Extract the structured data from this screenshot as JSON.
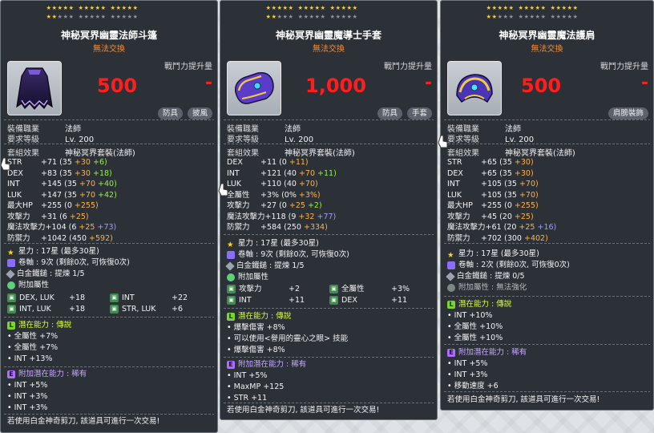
{
  "tooltips": [
    {
      "stars_row1": "★★★★★ ★★★★★ ★★★★★",
      "stars_row2": "★★★★★ ★★★★★ ★★★★★",
      "stars_filled": 17,
      "title": "神秘冥界幽靈法師斗篷",
      "untradable": "無法交換",
      "power_label": "戰鬥力提升量",
      "power_value": "500",
      "power_dash": "-",
      "icon": "cape-icon",
      "tags": [
        "防具",
        "披風"
      ],
      "job_label": "裝備職業",
      "job_value": "法師",
      "level_label": "要求等級",
      "level_value": "Lv. 200",
      "set_label": "套組效果",
      "set_value": "神秘冥界套裝(法師)",
      "stats": [
        [
          "STR",
          "+71",
          "(35",
          "+30",
          "+6)"
        ],
        [
          "DEX",
          "+83",
          "(35",
          "+30",
          "+18)"
        ],
        [
          "INT",
          "+145",
          "(35",
          "+70",
          "+40)"
        ],
        [
          "LUK",
          "+147",
          "(35",
          "+70",
          "+42)"
        ],
        [
          "最大HP",
          "+255",
          "(0",
          "+255)",
          ""
        ],
        [
          "攻擊力",
          "+31",
          "(6",
          "+25)",
          ""
        ],
        [
          "魔法攻擊力",
          "+104",
          "(6",
          "+25",
          "+73)"
        ],
        [
          "防禦力",
          "+1042",
          "(450",
          "+592)",
          ""
        ]
      ],
      "star_force": "星力 : 17星 (最多30星)",
      "scroll": "卷軸 : 9次 (剩餘0次, 可恢復0次)",
      "hammer": "白金鐵鎚 : 提煉 1/5",
      "additional_title": "附加屬性",
      "additional": [
        [
          "DEX, LUK",
          "+18",
          "INT",
          "+22"
        ],
        [
          "INT, LUK",
          "+18",
          "STR, LUK",
          "+6"
        ]
      ],
      "potential_title": "潛在能力 : 傳說",
      "potential": [
        "全屬性 +7%",
        "全屬性 +7%",
        "INT +13%"
      ],
      "bonus_title": "附加潛在能力 : 稀有",
      "bonus": [
        "INT +5%",
        "INT +3%",
        "INT +3%"
      ],
      "footer": "若使用白金神奇剪刀, 該道具可進行一次交易!"
    },
    {
      "stars_row1": "★★★★★ ★★★★★ ★★★★★",
      "stars_row2": "★★★★★ ★★★★★ ★★★★★",
      "stars_filled": 17,
      "title": "神秘冥界幽靈魔導士手套",
      "untradable": "無法交換",
      "power_label": "戰鬥力提升量",
      "power_value": "1,000",
      "power_dash": "-",
      "icon": "glove-icon",
      "tags": [
        "防具",
        "手套"
      ],
      "job_label": "裝備職業",
      "job_value": "法師",
      "level_label": "要求等級",
      "level_value": "Lv. 200",
      "set_label": "套組效果",
      "set_value": "神秘冥界套裝(法師)",
      "stats": [
        [
          "DEX",
          "+11",
          "(0",
          "+11)",
          ""
        ],
        [
          "INT",
          "+121",
          "(40",
          "+70",
          "+11)"
        ],
        [
          "LUK",
          "+110",
          "(40",
          "+70)",
          ""
        ],
        [
          "全屬性",
          "+3%",
          "(0%",
          "+3%)",
          ""
        ],
        [
          "攻擊力",
          "+27",
          "(0",
          "+25",
          "+2)"
        ],
        [
          "魔法攻擊力",
          "+118",
          "(9",
          "+32",
          "+77)"
        ],
        [
          "防禦力",
          "+584",
          "(250",
          "+334)",
          ""
        ]
      ],
      "star_force": "星力 : 17星 (最多30星)",
      "scroll": "卷軸 : 9次 (剩餘0次, 可恢復0次)",
      "hammer": "白金鐵鎚 : 提煉 1/5",
      "additional_title": "附加屬性",
      "additional": [
        [
          "攻擊力",
          "+2",
          "全屬性",
          "+3%"
        ],
        [
          "INT",
          "+11",
          "DEX",
          "+11"
        ]
      ],
      "potential_title": "潛在能力 : 傳說",
      "potential": [
        "爆擊傷害 +8%",
        "可以使用<譽用的靈心之眼> 技能",
        "爆擊傷害 +8%"
      ],
      "bonus_title": "附加潛在能力 : 稀有",
      "bonus": [
        "INT +5%",
        "MaxMP +125",
        "STR +11"
      ],
      "footer": "若使用白金神奇剪刀, 該道具可進行一次交易!"
    },
    {
      "stars_row1": "★★★★★ ★★★★★ ★★★★★",
      "stars_row2": "★★★★★ ★★★★★ ★★★★★",
      "stars_filled": 17,
      "title": "神秘冥界幽靈魔法護肩",
      "untradable": "無法交換",
      "power_label": "戰鬥力提升量",
      "power_value": "500",
      "power_dash": "-",
      "icon": "shoulder-icon",
      "tags": [
        "肩膀裝飾"
      ],
      "job_label": "裝備職業",
      "job_value": "法師",
      "level_label": "要求等級",
      "level_value": "Lv. 200",
      "set_label": "套組效果",
      "set_value": "神秘冥界套裝(法師)",
      "stats": [
        [
          "STR",
          "+65",
          "(35",
          "+30)",
          ""
        ],
        [
          "DEX",
          "+65",
          "(35",
          "+30)",
          ""
        ],
        [
          "INT",
          "+105",
          "(35",
          "+70)",
          ""
        ],
        [
          "LUK",
          "+105",
          "(35",
          "+70)",
          ""
        ],
        [
          "最大HP",
          "+255",
          "(0",
          "+255)",
          ""
        ],
        [
          "攻擊力",
          "+45",
          "(20",
          "+25)",
          ""
        ],
        [
          "魔法攻擊力",
          "+61",
          "(20",
          "+25",
          "+16)"
        ],
        [
          "防禦力",
          "+702",
          "(300",
          "+402)",
          ""
        ]
      ],
      "star_force": "星力 : 17星 (最多30星)",
      "scroll": "卷軸 : 2次 (剩餘0次, 可恢復0次)",
      "hammer": "白金鐵鎚 : 提煉 0/5",
      "additional_title": "附加屬性 : 無法強化",
      "additional": [],
      "potential_title": "潛在能力 : 傳說",
      "potential": [
        "INT +10%",
        "全屬性 +10%",
        "全屬性 +10%"
      ],
      "bonus_title": "附加潛在能力 : 稀有",
      "bonus": [
        "INT +5%",
        "INT +3%",
        "移動速度 +6"
      ],
      "footer": "若使用白金神奇剪刀, 該道具可進行一次交易!"
    }
  ],
  "colors": {
    "panel": "#2c3138",
    "power": "#ff1e1e",
    "star": "#ffd32a",
    "legend": "#7bd62b",
    "epic": "#b06cff"
  }
}
